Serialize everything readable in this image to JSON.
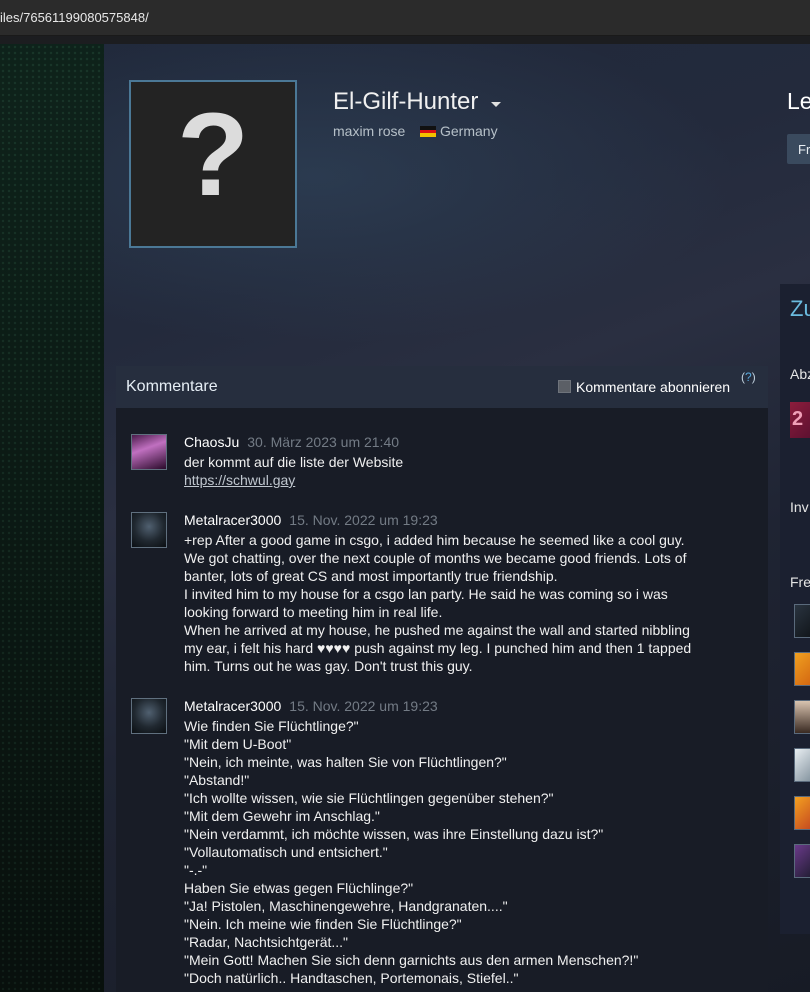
{
  "browser": {
    "url": "iles/76561199080575848/"
  },
  "profile": {
    "persona_name": "El-Gilf-Hunter",
    "real_name": "maxim rose",
    "country": "Germany",
    "avatar_placeholder": "?",
    "level_label": "Le",
    "friend_button_label": "Fr"
  },
  "right_panel": {
    "title": "Zu",
    "abz_label": "Abz",
    "badge_text": "2",
    "inv_label": "Inv",
    "fre_label": "Fre"
  },
  "comments": {
    "title": "Kommentare",
    "subscribe_label": "Kommentare abonnieren",
    "help_open": "(",
    "help_q": "?",
    "help_close": ")",
    "items": [
      {
        "author": "ChaosJu",
        "date": "30. März 2023 um 21:40",
        "text": "der kommt auf die liste der Website",
        "link": "https://schwul.gay"
      },
      {
        "author": "Metalracer3000",
        "date": "15. Nov. 2022 um 19:23",
        "text": "+rep After a good game in csgo, i added him because he seemed like a cool guy.\nWe got chatting, over the next couple of months we became good friends. Lots of\nbanter, lots of great CS and most importantly true friendship.\nI invited him to my house for a csgo lan party. He said he was coming so i was\nlooking forward to meeting him in real life.\nWhen he arrived at my house, he pushed me against the wall and started nibbling\nmy ear, i felt his hard ♥♥♥♥ push against my leg. I punched him and then 1 tapped\nhim. Turns out he was gay. Don't trust this guy."
      },
      {
        "author": "Metalracer3000",
        "date": "15. Nov. 2022 um 19:23",
        "text": "Wie finden Sie Flüchtlinge?\"\n\"Mit dem U-Boot\"\n\"Nein, ich meinte, was halten Sie von Flüchtlingen?\"\n\"Abstand!\"\n\"Ich wollte wissen, wie sie Flüchtlingen gegenüber stehen?\"\n\"Mit dem Gewehr im Anschlag.\"\n\"Nein verdammt, ich möchte wissen, was ihre Einstellung dazu ist?\"\n\"Vollautomatisch und entsichert.\"\n\"-.-\"\nHaben Sie etwas gegen Flüchlinge?\"\n\"Ja! Pistolen, Maschinengewehre, Handgranaten....\"\n\"Nein. Ich meine wie finden Sie Flüchtlinge?\"\n\"Radar, Nachtsichtgerät...\"\n\"Mein Gott! Machen Sie sich denn garnichts aus den armen Menschen?!\"\n\"Doch natürlich.. Handtaschen, Portemonais, Stiefel..\""
      }
    ]
  },
  "colors": {
    "accent": "#6bbbdf",
    "avatar_border": "#4b7896",
    "comment_date": "#737b85"
  }
}
